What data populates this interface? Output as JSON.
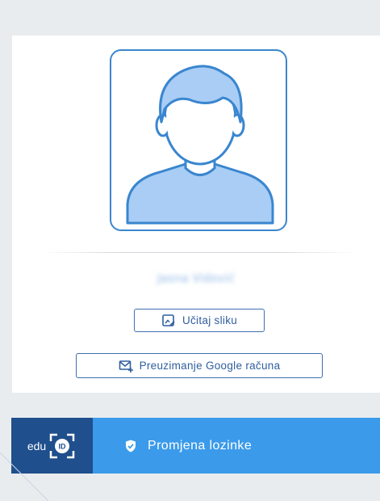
{
  "profile": {
    "user_name": "Jasna Vidović",
    "upload_photo_label": "Učitaj sliku",
    "google_account_label": "Preuzimanje Google računa"
  },
  "footer_bar": {
    "logo_text": "edu",
    "logo_id_text": "ID",
    "password_change_label": "Promjena lozinke"
  },
  "icons": {
    "avatar": "user-silhouette-icon",
    "upload": "image-edit-icon",
    "google": "mail-plus-icon",
    "password": "shield-check-icon"
  },
  "colors": {
    "accent": "#3b9bea",
    "logo_bg": "#1f4f8c",
    "avatar_stroke": "#3a86cf",
    "avatar_fill": "#a9cdf5",
    "button_text": "#2f5e9f"
  }
}
